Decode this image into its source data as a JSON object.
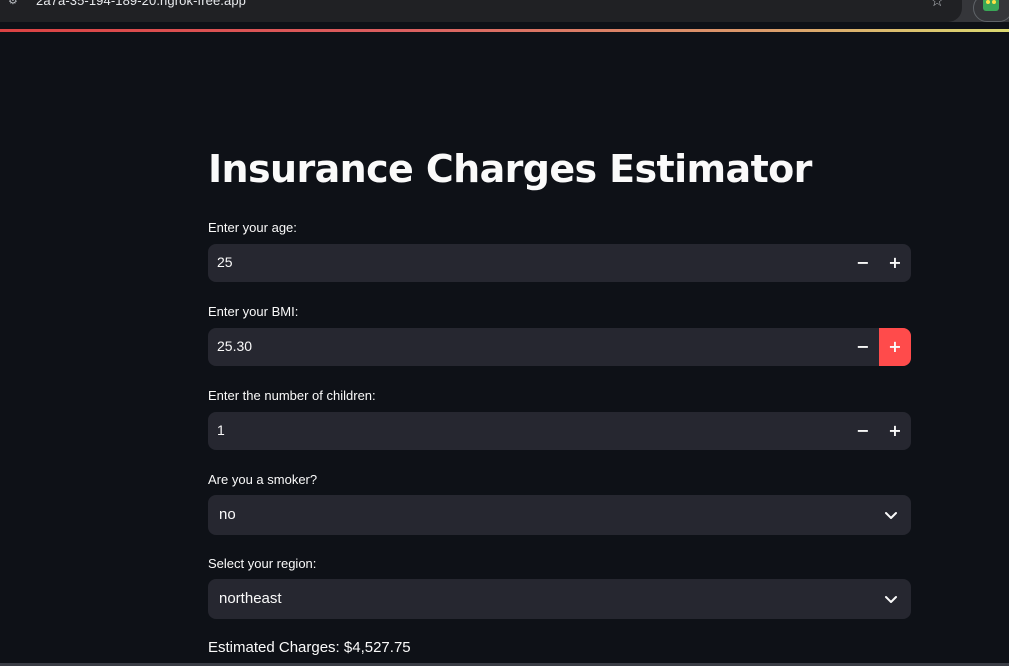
{
  "browser": {
    "url": "2a7a-35-194-189-20.ngrok-free.app"
  },
  "app": {
    "title": "Insurance Charges Estimator",
    "age": {
      "label": "Enter your age:",
      "value": "25",
      "minus": "−",
      "plus": "+"
    },
    "bmi": {
      "label": "Enter your BMI:",
      "value": "25.30",
      "minus": "−",
      "plus": "+"
    },
    "children": {
      "label": "Enter the number of children:",
      "value": "1",
      "minus": "−",
      "plus": "+"
    },
    "smoker": {
      "label": "Are you a smoker?",
      "value": "no"
    },
    "region": {
      "label": "Select your region:",
      "value": "northeast"
    },
    "result": "Estimated Charges: $4,527.75"
  },
  "colors": {
    "background": "#0e1117",
    "input_bg": "#262730",
    "accent": "#ff4b4b"
  }
}
